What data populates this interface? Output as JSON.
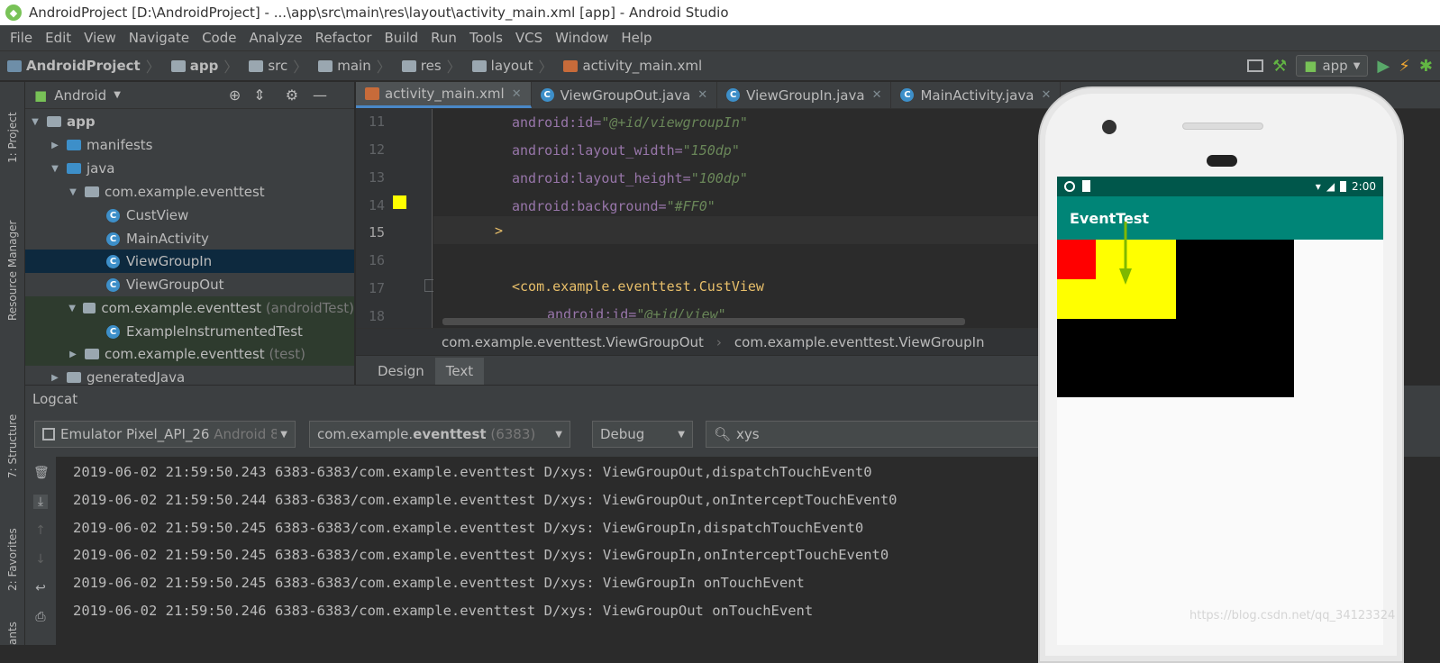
{
  "window": {
    "title": "AndroidProject [D:\\AndroidProject] - ...\\app\\src\\main\\res\\layout\\activity_main.xml [app] - Android Studio"
  },
  "menu": [
    "File",
    "Edit",
    "View",
    "Navigate",
    "Code",
    "Analyze",
    "Refactor",
    "Build",
    "Run",
    "Tools",
    "VCS",
    "Window",
    "Help"
  ],
  "breadcrumb": [
    "AndroidProject",
    "app",
    "src",
    "main",
    "res",
    "layout",
    "activity_main.xml"
  ],
  "toolbar": {
    "run_config": "app"
  },
  "side_tabs": {
    "project": "1: Project",
    "resource_manager": "Resource Manager",
    "structure": "7: Structure",
    "favorites": "2: Favorites",
    "build_variants": "ants"
  },
  "project_panel": {
    "view_mode": "Android",
    "tree": [
      {
        "label": "app",
        "suffix": ""
      },
      {
        "label": "manifests",
        "suffix": ""
      },
      {
        "label": "java",
        "suffix": ""
      },
      {
        "label": "com.example.eventtest",
        "suffix": ""
      },
      {
        "label": "CustView",
        "suffix": ""
      },
      {
        "label": "MainActivity",
        "suffix": ""
      },
      {
        "label": "ViewGroupIn",
        "suffix": ""
      },
      {
        "label": "ViewGroupOut",
        "suffix": ""
      },
      {
        "label": "com.example.eventtest",
        "suffix": "(androidTest)"
      },
      {
        "label": "ExampleInstrumentedTest",
        "suffix": ""
      },
      {
        "label": "com.example.eventtest",
        "suffix": "(test)"
      },
      {
        "label": "generatedJava",
        "suffix": ""
      }
    ]
  },
  "editor": {
    "tabs": [
      "activity_main.xml",
      "ViewGroupOut.java",
      "ViewGroupIn.java",
      "MainActivity.java"
    ],
    "line_numbers": [
      "11",
      "12",
      "13",
      "14",
      "15",
      "16",
      "17",
      "18"
    ],
    "lines": [
      {
        "attr": "android:id=",
        "val": "\"@+id/viewgroupIn\"",
        "tag": ""
      },
      {
        "attr": "android:layout_width=",
        "val": "\"150dp\"",
        "tag": ""
      },
      {
        "attr": "android:layout_height=",
        "val": "\"100dp\"",
        "tag": ""
      },
      {
        "attr": "android:background=",
        "val": "\"#FF0\"",
        "tag": ""
      },
      {
        "attr": "",
        "val": "",
        "tag": ">"
      },
      {
        "attr": "",
        "val": "",
        "tag": ""
      },
      {
        "attr": "",
        "val": "",
        "tag": "<com.example.eventtest.CustView"
      },
      {
        "attr": "android:id=",
        "val": "\"@+id/view\"",
        "tag": ""
      }
    ],
    "xml_path": [
      "com.example.eventtest.ViewGroupOut",
      "com.example.eventtest.ViewGroupIn"
    ],
    "mode_tabs": [
      "Design",
      "Text"
    ]
  },
  "logcat": {
    "title": "Logcat",
    "device": "Emulator Pixel_API_26",
    "device_suffix": "Android 8",
    "process_prefix": "com.example.",
    "process_bold": "eventtest",
    "process_pid": "(6383)",
    "level": "Debug",
    "search": "xys",
    "lines": [
      "2019-06-02 21:59:50.243 6383-6383/com.example.eventtest D/xys: ViewGroupOut,dispatchTouchEvent0",
      "2019-06-02 21:59:50.244 6383-6383/com.example.eventtest D/xys: ViewGroupOut,onInterceptTouchEvent0",
      "2019-06-02 21:59:50.245 6383-6383/com.example.eventtest D/xys: ViewGroupIn,dispatchTouchEvent0",
      "2019-06-02 21:59:50.245 6383-6383/com.example.eventtest D/xys: ViewGroupIn,onInterceptTouchEvent0",
      "2019-06-02 21:59:50.245 6383-6383/com.example.eventtest D/xys: ViewGroupIn onTouchEvent",
      "2019-06-02 21:59:50.246 6383-6383/com.example.eventtest D/xys: ViewGroupOut onTouchEvent"
    ]
  },
  "emulator": {
    "clock": "2:00",
    "app_title": "EventTest",
    "colors": {
      "status": "#00574b",
      "appbar": "#008577",
      "outer": "#000000",
      "inner": "#ffff00",
      "cust": "#ff0000"
    }
  },
  "watermark": "https://blog.csdn.net/qq_34123324"
}
